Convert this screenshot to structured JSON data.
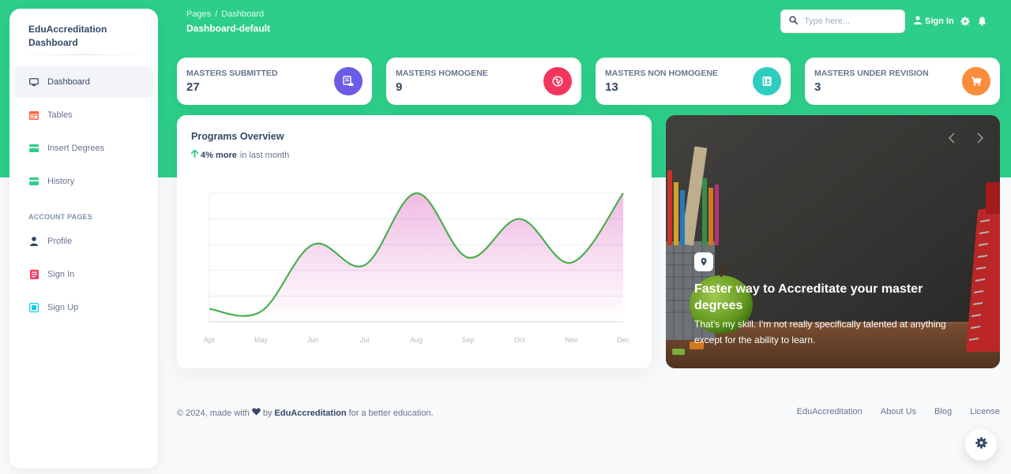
{
  "brand": {
    "line1": "EduAccreditation",
    "line2": "Dashboard"
  },
  "sidebar": {
    "items": [
      {
        "label": "Dashboard",
        "icon": "monitor-icon"
      },
      {
        "label": "Tables",
        "icon": "calendar-icon"
      },
      {
        "label": "Insert Degrees",
        "icon": "credit-card-icon"
      },
      {
        "label": "History",
        "icon": "credit-card-icon"
      }
    ],
    "section_title": "ACCOUNT PAGES",
    "account_items": [
      {
        "label": "Profile",
        "icon": "user-icon"
      },
      {
        "label": "Sign In",
        "icon": "document-icon"
      },
      {
        "label": "Sign Up",
        "icon": "collection-icon"
      }
    ]
  },
  "header": {
    "breadcrumb_root": "Pages",
    "breadcrumb_sep": "/",
    "breadcrumb_current": "Dashboard",
    "title": "Dashboard-default",
    "search_placeholder": "Type here...",
    "signin_label": "Sign In"
  },
  "stats": [
    {
      "label": "MASTERS SUBMITTED",
      "value": "27",
      "icon": "database-icon",
      "color": "#6b5ce7"
    },
    {
      "label": "MASTERS HOMOGENE",
      "value": "9",
      "icon": "globe-icon",
      "color": "#f5365c"
    },
    {
      "label": "MASTERS NON HOMOGENE",
      "value": "13",
      "icon": "badge-icon",
      "color": "#2dcec0"
    },
    {
      "label": "MASTERS UNDER REVISION",
      "value": "3",
      "icon": "cart-icon",
      "color": "#fb8c3c"
    }
  ],
  "overview": {
    "title": "Programs Overview",
    "trend_value": "4% more",
    "trend_text": "in last month"
  },
  "chart_data": {
    "type": "line",
    "categories": [
      "Apr",
      "May",
      "Jun",
      "Jul",
      "Aug",
      "Sep",
      "Oct",
      "Nov",
      "Dec"
    ],
    "series": [
      {
        "values": [
          50,
          40,
          300,
          220,
          500,
          250,
          400,
          230,
          500
        ]
      }
    ],
    "ylim": [
      0,
      500
    ],
    "grid": true,
    "line_color": "#4caf50",
    "fill_color": "#cb0c9f"
  },
  "carousel": {
    "title": "Faster way to Accreditate your master degrees",
    "text": "That's my skill. I'm not really specifically talented at anything except for the ability to learn."
  },
  "footer": {
    "copyright": "© 2024, made with",
    "by": "by",
    "brand": "EduAccreditation",
    "tagline": "for a better education.",
    "links": [
      "EduAccreditation",
      "About Us",
      "Blog",
      "License"
    ]
  },
  "colors": {
    "accent": "#2dce89",
    "text": "#344767",
    "muted": "#67748e"
  }
}
